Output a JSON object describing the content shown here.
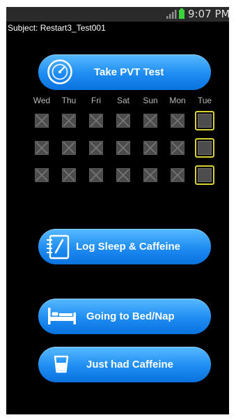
{
  "status_bar": {
    "time": "9:07 PM",
    "icons": [
      "signal-icon",
      "battery-icon"
    ],
    "battery_color": "#3cd23c"
  },
  "subject": {
    "text": "Subject: Restart3_Test001"
  },
  "buttons": {
    "pvt": {
      "label": "Take PVT Test",
      "icon": "gauge-icon"
    },
    "log": {
      "label": "Log Sleep & Caffeine",
      "icon": "notebook-icon"
    },
    "bed": {
      "label": "Going to Bed/Nap",
      "icon": "bed-icon"
    },
    "caffeine": {
      "label": "Just had Caffeine",
      "icon": "cup-icon"
    }
  },
  "calendar": {
    "days": [
      "Wed",
      "Thu",
      "Fri",
      "Sat",
      "Sun",
      "Mon",
      "Tue"
    ],
    "rows": 3,
    "active_day": "Tue",
    "highlight_color": "#d8d236"
  },
  "colors": {
    "button_accent": "#1e8cf2",
    "background": "#000000"
  }
}
